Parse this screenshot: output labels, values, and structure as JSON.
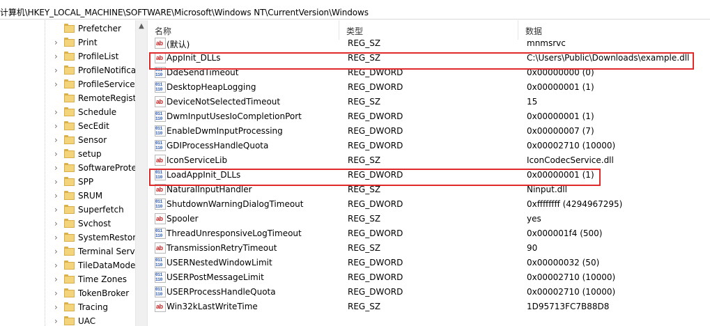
{
  "address": {
    "path": "计算机\\HKEY_LOCAL_MACHINE\\SOFTWARE\\Microsoft\\Windows NT\\CurrentVersion\\Windows"
  },
  "tree": {
    "items": [
      {
        "label": "Prefetcher",
        "has_chevron": false
      },
      {
        "label": "Print",
        "has_chevron": true
      },
      {
        "label": "ProfileList",
        "has_chevron": true
      },
      {
        "label": "ProfileNotifica",
        "has_chevron": true
      },
      {
        "label": "ProfileService",
        "has_chevron": true
      },
      {
        "label": "RemoteRegist",
        "has_chevron": false
      },
      {
        "label": "Schedule",
        "has_chevron": true
      },
      {
        "label": "SecEdit",
        "has_chevron": true
      },
      {
        "label": "Sensor",
        "has_chevron": true
      },
      {
        "label": "setup",
        "has_chevron": true
      },
      {
        "label": "SoftwareProte",
        "has_chevron": true
      },
      {
        "label": "SPP",
        "has_chevron": true
      },
      {
        "label": "SRUM",
        "has_chevron": true
      },
      {
        "label": "Superfetch",
        "has_chevron": true
      },
      {
        "label": "Svchost",
        "has_chevron": true
      },
      {
        "label": "SystemRestor",
        "has_chevron": true
      },
      {
        "label": "Terminal Serv",
        "has_chevron": true
      },
      {
        "label": "TileDataMode",
        "has_chevron": true
      },
      {
        "label": "Time Zones",
        "has_chevron": true
      },
      {
        "label": "TokenBroker",
        "has_chevron": true
      },
      {
        "label": "Tracing",
        "has_chevron": true
      },
      {
        "label": "UAC",
        "has_chevron": true
      }
    ]
  },
  "list": {
    "columns": [
      "名称",
      "类型",
      "数据"
    ],
    "rows": [
      {
        "name": "(默认)",
        "type": "REG_SZ",
        "value": "mnmsrvc",
        "icon": "string-value-icon",
        "highlight": false
      },
      {
        "name": "AppInit_DLLs",
        "type": "REG_SZ",
        "value": "C:\\Users\\Public\\Downloads\\example.dll",
        "icon": "string-value-icon",
        "highlight": true
      },
      {
        "name": "DdeSendTimeout",
        "type": "REG_DWORD",
        "value": "0x00000000 (0)",
        "icon": "dword-value-icon",
        "highlight": false
      },
      {
        "name": "DesktopHeapLogging",
        "type": "REG_DWORD",
        "value": "0x00000001 (1)",
        "icon": "dword-value-icon",
        "highlight": false
      },
      {
        "name": "DeviceNotSelectedTimeout",
        "type": "REG_SZ",
        "value": "15",
        "icon": "string-value-icon",
        "highlight": false
      },
      {
        "name": "DwmInputUsesIoCompletionPort",
        "type": "REG_DWORD",
        "value": "0x00000001 (1)",
        "icon": "dword-value-icon",
        "highlight": false
      },
      {
        "name": "EnableDwmInputProcessing",
        "type": "REG_DWORD",
        "value": "0x00000007 (7)",
        "icon": "dword-value-icon",
        "highlight": false
      },
      {
        "name": "GDIProcessHandleQuota",
        "type": "REG_DWORD",
        "value": "0x00002710 (10000)",
        "icon": "dword-value-icon",
        "highlight": false
      },
      {
        "name": "IconServiceLib",
        "type": "REG_SZ",
        "value": "IconCodecService.dll",
        "icon": "string-value-icon",
        "highlight": false
      },
      {
        "name": "LoadAppInit_DLLs",
        "type": "REG_DWORD",
        "value": "0x00000001 (1)",
        "icon": "dword-value-icon",
        "highlight": true
      },
      {
        "name": "NaturalInputHandler",
        "type": "REG_SZ",
        "value": "Ninput.dll",
        "icon": "string-value-icon",
        "highlight": false
      },
      {
        "name": "ShutdownWarningDialogTimeout",
        "type": "REG_DWORD",
        "value": "0xffffffff (4294967295)",
        "icon": "dword-value-icon",
        "highlight": false
      },
      {
        "name": "Spooler",
        "type": "REG_SZ",
        "value": "yes",
        "icon": "string-value-icon",
        "highlight": false
      },
      {
        "name": "ThreadUnresponsiveLogTimeout",
        "type": "REG_DWORD",
        "value": "0x000001f4 (500)",
        "icon": "dword-value-icon",
        "highlight": false
      },
      {
        "name": "TransmissionRetryTimeout",
        "type": "REG_SZ",
        "value": "90",
        "icon": "string-value-icon",
        "highlight": false
      },
      {
        "name": "USERNestedWindowLimit",
        "type": "REG_DWORD",
        "value": "0x00000032 (50)",
        "icon": "dword-value-icon",
        "highlight": false
      },
      {
        "name": "USERPostMessageLimit",
        "type": "REG_DWORD",
        "value": "0x00002710 (10000)",
        "icon": "dword-value-icon",
        "highlight": false
      },
      {
        "name": "USERProcessHandleQuota",
        "type": "REG_DWORD",
        "value": "0x00002710 (10000)",
        "icon": "dword-value-icon",
        "highlight": false
      },
      {
        "name": "Win32kLastWriteTime",
        "type": "REG_SZ",
        "value": "1D95713FC7B88D8",
        "icon": "string-value-icon",
        "highlight": false
      }
    ]
  },
  "colors": {
    "highlight": "#e0292a"
  }
}
